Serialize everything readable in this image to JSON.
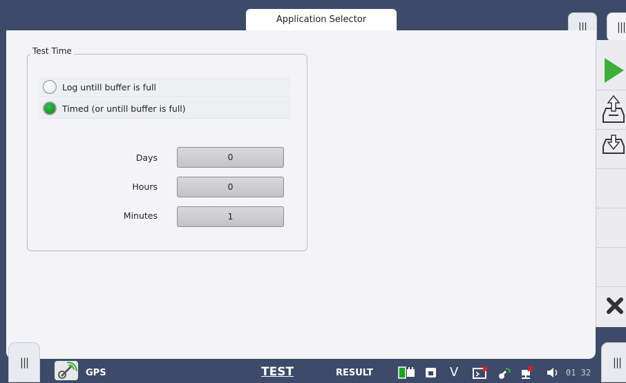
{
  "header": {
    "title": "Application Selector"
  },
  "group": {
    "title": "Test Time",
    "options": [
      {
        "label": "Log untill buffer is full",
        "selected": false
      },
      {
        "label": "Timed (or untill buffer is  full)",
        "selected": true
      }
    ],
    "fields": [
      {
        "label": "Days",
        "value": "0"
      },
      {
        "label": "Hours",
        "value": "0"
      },
      {
        "label": "Minutes",
        "value": "1"
      }
    ]
  },
  "bottom_bar": {
    "gps_label": "GPS",
    "test_tab": "TEST",
    "result_tab": "RESULT",
    "v_label": "V",
    "time": "01 32"
  },
  "icons": {
    "tab_handle": "|||"
  },
  "colors": {
    "frame": "#3d4b68",
    "play_green": "#3fae3a",
    "radio_selected": "#0b7d1d",
    "close_dark": "#333333"
  }
}
